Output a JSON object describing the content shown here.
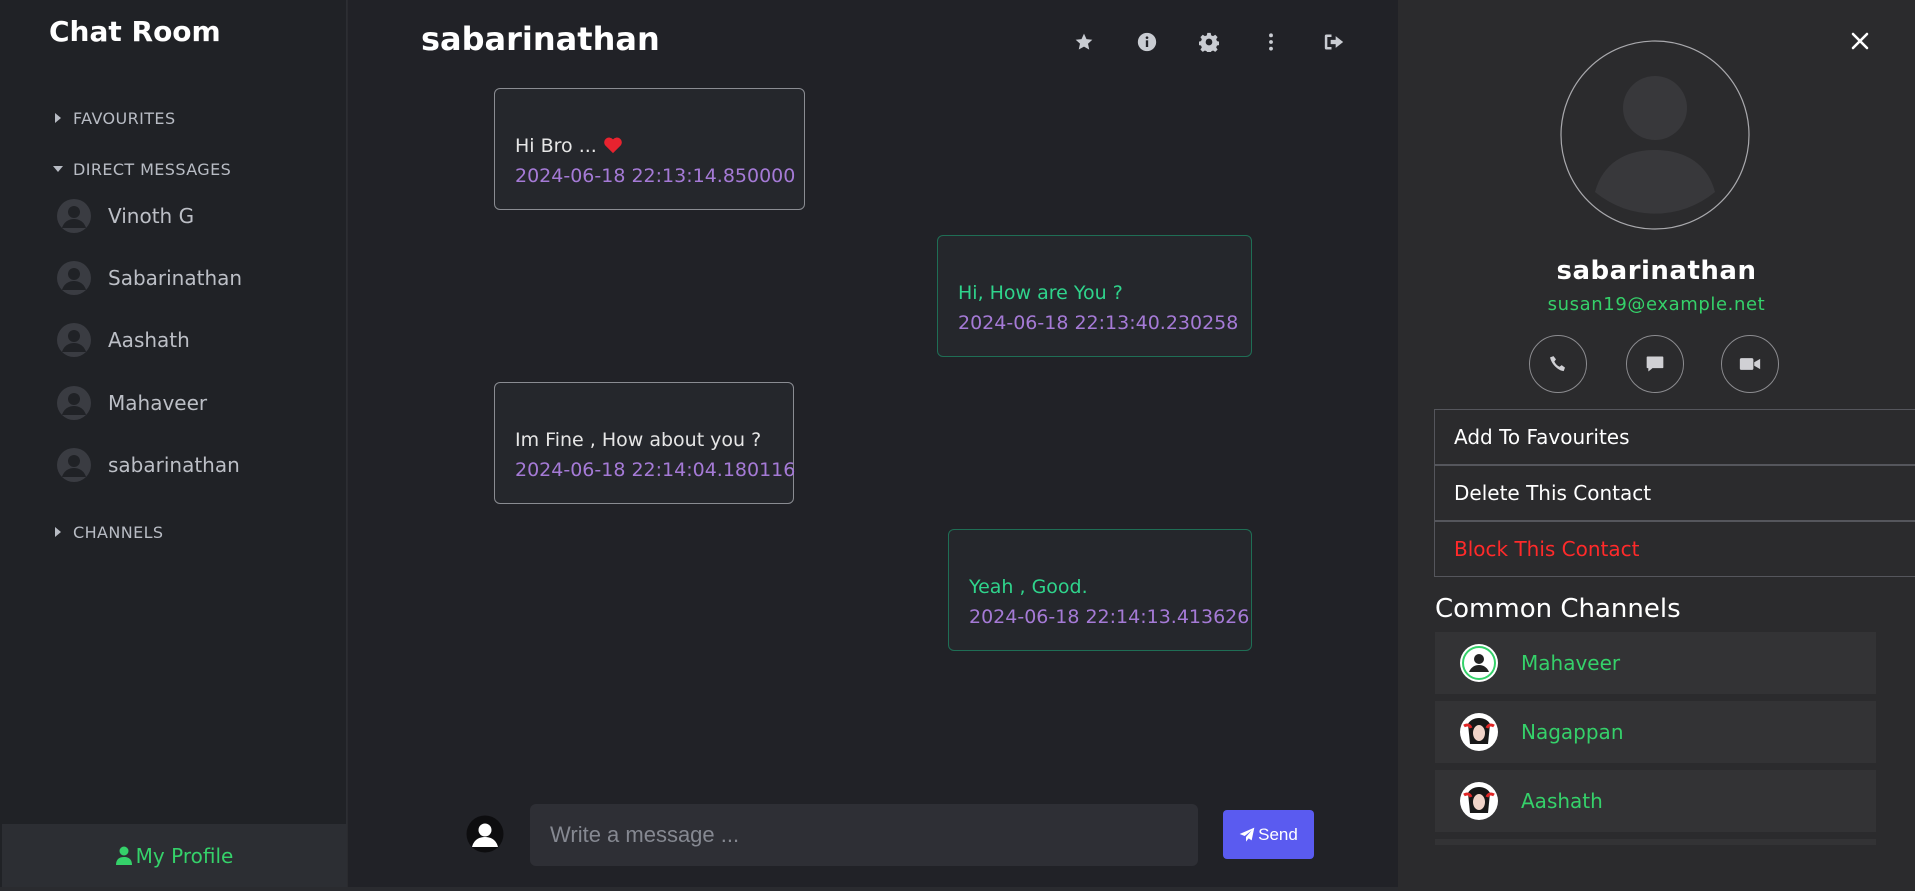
{
  "sidebar": {
    "app_title": "Chat Room",
    "favourites_label": "FAVOURITES",
    "direct_messages_label": "DIRECT MESSAGES",
    "channels_label": "CHANNELS",
    "contacts": [
      {
        "name": "Vinoth G"
      },
      {
        "name": "Sabarinathan"
      },
      {
        "name": "Aashath"
      },
      {
        "name": "Mahaveer"
      },
      {
        "name": "sabarinathan"
      }
    ],
    "my_profile_label": "My Profile"
  },
  "chat": {
    "title": "sabarinathan",
    "messages": [
      {
        "direction": "in",
        "text": "Hi Bro ...",
        "has_heart": true,
        "time": "2024-06-18 22:13:14.850000"
      },
      {
        "direction": "out",
        "text": "Hi, How are You ?",
        "time": "2024-06-18 22:13:40.230258"
      },
      {
        "direction": "in",
        "text": "Im Fine , How about you ?",
        "time": "2024-06-18 22:14:04.180116"
      },
      {
        "direction": "out",
        "text": "Yeah , Good.",
        "time": "2024-06-18 22:14:13.413626"
      }
    ],
    "input_placeholder": "Write a message ...",
    "send_label": "Send"
  },
  "contact_panel": {
    "name": "sabarinathan",
    "email": "susan19@example.net",
    "actions": {
      "add_favourites": "Add To Favourites",
      "delete_contact": "Delete This Contact",
      "block_contact": "Block This Contact"
    },
    "common_channels_heading": "Common Channels",
    "channels": [
      {
        "name": "Mahaveer"
      },
      {
        "name": "Nagappan"
      },
      {
        "name": "Aashath"
      }
    ]
  },
  "colors": {
    "accent_green": "#35d16a",
    "outgoing_text": "#2fd48c",
    "timestamp_purple": "#a57ad6",
    "send_button": "#5a5bf0",
    "block_red": "#ff2a2a"
  },
  "icons": {
    "header": [
      "star-icon",
      "info-icon",
      "gear-icon",
      "ellipsis-vertical-icon",
      "logout-icon"
    ],
    "contact_actions": [
      "phone-icon",
      "message-icon",
      "video-icon"
    ]
  }
}
